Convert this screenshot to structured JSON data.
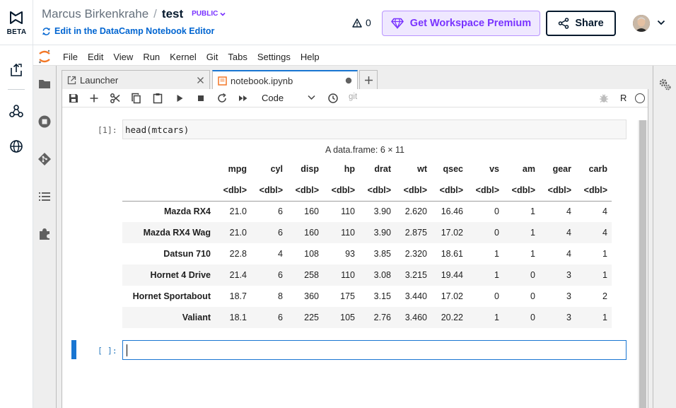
{
  "header": {
    "beta_label": "BETA",
    "owner": "Marcus Birkenkrahe",
    "separator": "/",
    "notebook_title": "test",
    "visibility": "PUBLIC",
    "edit_link": "Edit in the DataCamp Notebook Editor",
    "alert_count": "0",
    "premium_button": "Get Workspace Premium",
    "share_button": "Share"
  },
  "menu": [
    "File",
    "Edit",
    "View",
    "Run",
    "Kernel",
    "Git",
    "Tabs",
    "Settings",
    "Help"
  ],
  "tabs": [
    {
      "label": "Launcher",
      "active": false
    },
    {
      "label": "notebook.ipynb",
      "active": true
    }
  ],
  "toolbar": {
    "cell_type": "Code",
    "git_label": "git",
    "kernel": "R"
  },
  "cells": [
    {
      "prompt": "[1]:",
      "source": "head(mtcars)"
    },
    {
      "prompt": "[ ]:",
      "source": ""
    }
  ],
  "dataframe": {
    "caption": "A data.frame: 6 × 11",
    "columns": [
      "mpg",
      "cyl",
      "disp",
      "hp",
      "drat",
      "wt",
      "qsec",
      "vs",
      "am",
      "gear",
      "carb"
    ],
    "types": [
      "<dbl>",
      "<dbl>",
      "<dbl>",
      "<dbl>",
      "<dbl>",
      "<dbl>",
      "<dbl>",
      "<dbl>",
      "<dbl>",
      "<dbl>",
      "<dbl>"
    ],
    "rows": [
      {
        "name": "Mazda RX4",
        "values": [
          "21.0",
          "6",
          "160",
          "110",
          "3.90",
          "2.620",
          "16.46",
          "0",
          "1",
          "4",
          "4"
        ]
      },
      {
        "name": "Mazda RX4 Wag",
        "values": [
          "21.0",
          "6",
          "160",
          "110",
          "3.90",
          "2.875",
          "17.02",
          "0",
          "1",
          "4",
          "4"
        ]
      },
      {
        "name": "Datsun 710",
        "values": [
          "22.8",
          "4",
          "108",
          "93",
          "3.85",
          "2.320",
          "18.61",
          "1",
          "1",
          "4",
          "1"
        ]
      },
      {
        "name": "Hornet 4 Drive",
        "values": [
          "21.4",
          "6",
          "258",
          "110",
          "3.08",
          "3.215",
          "19.44",
          "1",
          "0",
          "3",
          "1"
        ]
      },
      {
        "name": "Hornet Sportabout",
        "values": [
          "18.7",
          "8",
          "360",
          "175",
          "3.15",
          "3.440",
          "17.02",
          "0",
          "0",
          "3",
          "2"
        ]
      },
      {
        "name": "Valiant",
        "values": [
          "18.1",
          "6",
          "225",
          "105",
          "2.76",
          "3.460",
          "20.22",
          "1",
          "0",
          "3",
          "1"
        ]
      }
    ]
  },
  "colors": {
    "accent_purple": "#7933ff",
    "link_blue": "#0065d1",
    "cell_active_blue": "#1976d2"
  },
  "icons": [
    "datacamp-logo-icon",
    "diamond-icon",
    "share-icon",
    "alert-triangle-icon",
    "chevron-down-icon"
  ]
}
